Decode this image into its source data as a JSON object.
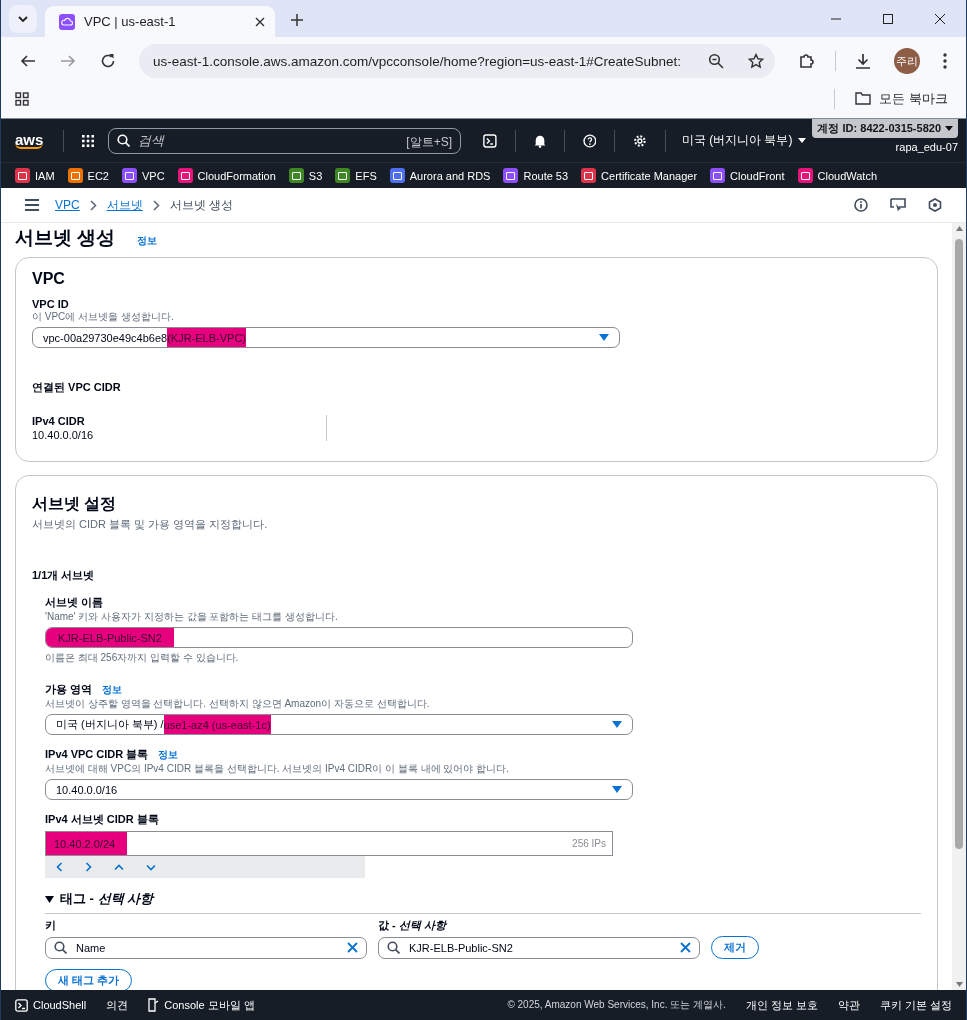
{
  "browser": {
    "tab_title": "VPC | us-east-1",
    "url": "us-east-1.console.aws.amazon.com/vpcconsole/home?region=us-east-1#CreateSubnet:",
    "avatar": "주리",
    "bookmarks_folder": "모든 북마크"
  },
  "header": {
    "logo": "aws",
    "search_placeholder": "검색",
    "search_shortcut": "[알트+S]",
    "region": "미국 (버지니아 북부)",
    "account": "계정 ID: 8422-0315-5820",
    "user": "rapa_edu-07"
  },
  "favorites": [
    {
      "label": "IAM",
      "color": "#dd344c"
    },
    {
      "label": "EC2",
      "color": "#ed7100"
    },
    {
      "label": "VPC",
      "color": "#8c4fff"
    },
    {
      "label": "CloudFormation",
      "color": "#e7157b"
    },
    {
      "label": "S3",
      "color": "#3f8624"
    },
    {
      "label": "EFS",
      "color": "#3f8624"
    },
    {
      "label": "Aurora and RDS",
      "color": "#4d6ff0"
    },
    {
      "label": "Route 53",
      "color": "#8c4fff"
    },
    {
      "label": "Certificate Manager",
      "color": "#dd344c"
    },
    {
      "label": "CloudFront",
      "color": "#8c4fff"
    },
    {
      "label": "CloudWatch",
      "color": "#e7157b"
    }
  ],
  "breadcrumb": [
    {
      "label": "VPC",
      "kind": "link"
    },
    {
      "label": "서브넷",
      "kind": "link"
    },
    {
      "label": "서브넷 생성",
      "kind": "current"
    }
  ],
  "page": {
    "title": "서브넷 생성",
    "info": "정보"
  },
  "vpc_panel": {
    "heading": "VPC",
    "label": "VPC ID",
    "description": "이 VPC에 서브넷을 생성합니다.",
    "value_parts": [
      {
        "text": "vpc-00a29730e49c4b6e8 ",
        "highlighted": false
      },
      {
        "text": "(KJR-ELB-VPC)",
        "highlighted": true
      }
    ],
    "cidr_heading": "연결된 VPC CIDR",
    "cidr_label": "IPv4 CIDR",
    "cidr_value": "10.40.0.0/16"
  },
  "subnet_panel": {
    "heading": "서브넷 설정",
    "description": "서브넷의 CIDR 블록 및 가용 영역을 지정합니다.",
    "count": "1/1개 서브넷",
    "name": {
      "label": "서브넷 이름",
      "description": "'Name' 키와 사용자가 지정하는 값을 포함하는 태그를 생성합니다.",
      "value": "KJR-ELB-Public-SN2",
      "highlighted": true,
      "hint": "이름은 최대 256자까지 입력할 수 있습니다."
    },
    "az": {
      "label": "가용 영역",
      "info": "정보",
      "description": "서브넷이 상주할 영역을 선택합니다. 선택하지 않으면 Amazon이 자동으로 선택합니다.",
      "value_parts": [
        {
          "text": "미국 (버지니아 북부) / ",
          "highlighted": false
        },
        {
          "text": "use1-az4 (us-east-1c)",
          "highlighted": true
        }
      ]
    },
    "vpc_cidr": {
      "label": "IPv4 VPC CIDR 블록",
      "info": "정보",
      "description": "서브넷에 대해 VPC의 IPv4 CIDR 블록을 선택합니다. 서브넷의 IPv4 CIDR이 이 블록 내에 있어야 합니다.",
      "value": "10.40.0.0/16"
    },
    "subnet_cidr": {
      "label": "IPv4 서브넷 CIDR 블록",
      "value": "10.40.2.0/24",
      "highlighted": true,
      "suffix": "256 IPs"
    },
    "tags": {
      "title": "태그 - *선택 사항*",
      "expanded": true,
      "key_label": "키",
      "value_label": "값 - *선택 사항*",
      "rows": [
        {
          "key": "Name",
          "value": "KJR-ELB-Public-SN2",
          "remove": "제거"
        }
      ],
      "add": "새 태그 추가"
    }
  },
  "footer": {
    "cloudshell": "CloudShell",
    "feedback": "의견",
    "mobile": "Console 모바일 앱",
    "copyright": "© 2025, Amazon Web Services, Inc. 또는 계열사.",
    "links": [
      "개인 정보 보호",
      "약관",
      "쿠키 기본 설정"
    ]
  }
}
